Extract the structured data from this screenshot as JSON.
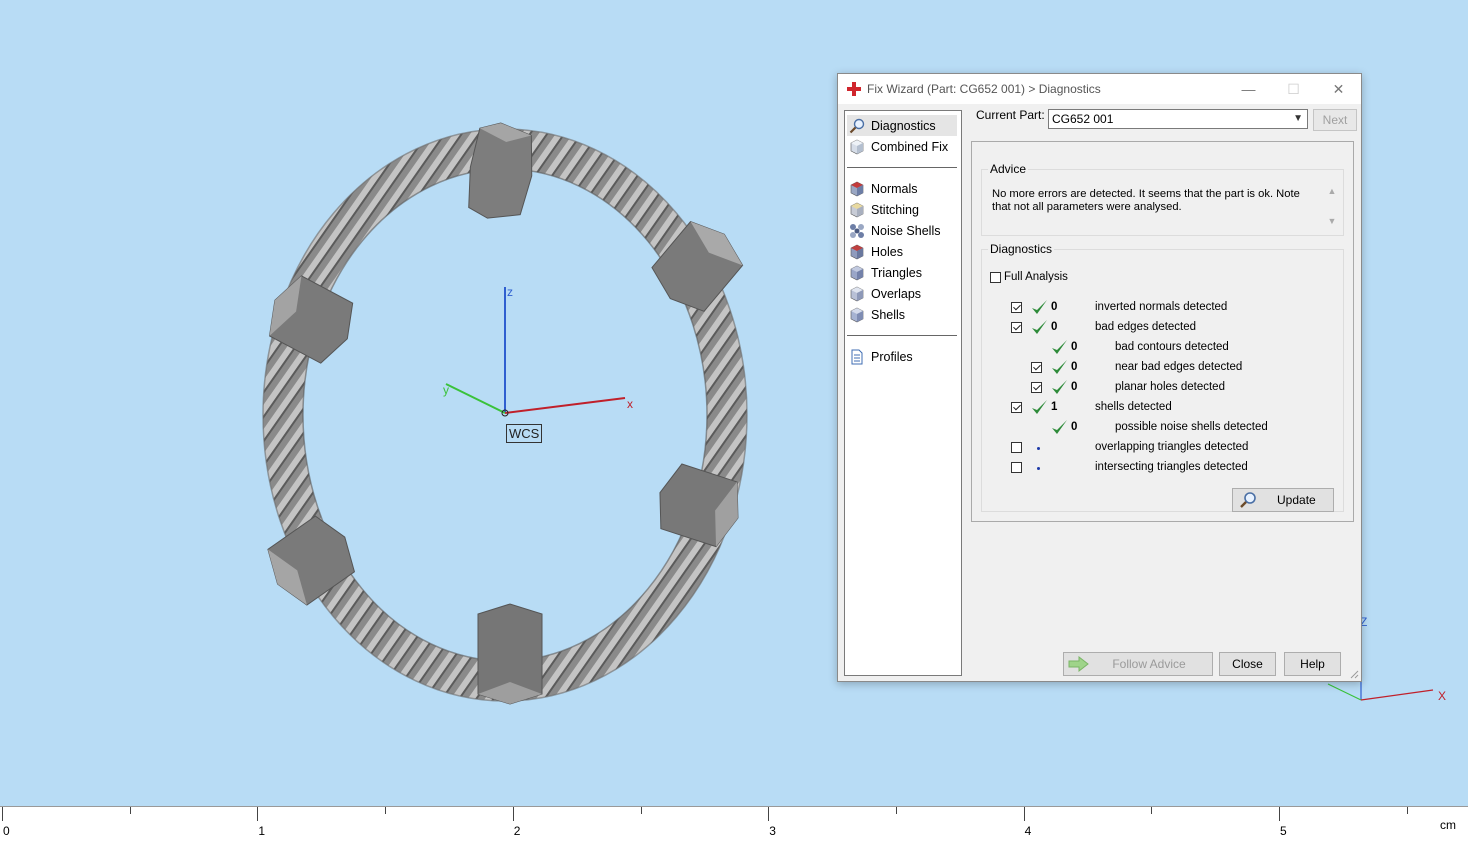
{
  "viewport": {
    "wcs_label": "WCS",
    "axis_labels": {
      "x": "x",
      "y": "y",
      "z": "z"
    },
    "mini_axis_labels": {
      "x": "X",
      "z": "Z"
    }
  },
  "ruler": {
    "ticks": [
      "0",
      "1",
      "2",
      "3",
      "4",
      "5"
    ],
    "unit": "cm"
  },
  "dialog": {
    "title": "Fix Wizard (Part: CG652 001) > Diagnostics",
    "window_buttons": {
      "minimize": "—",
      "maximize": "☐",
      "close": "✕"
    },
    "nav": {
      "top": [
        {
          "label": "Diagnostics",
          "icon": "magnifier-icon",
          "selected": true
        },
        {
          "label": "Combined Fix",
          "icon": "cube-icon"
        }
      ],
      "fixes": [
        {
          "label": "Normals",
          "icon": "normals-cube-icon"
        },
        {
          "label": "Stitching",
          "icon": "stitching-cube-icon"
        },
        {
          "label": "Noise Shells",
          "icon": "noise-shells-icon"
        },
        {
          "label": "Holes",
          "icon": "holes-cube-icon"
        },
        {
          "label": "Triangles",
          "icon": "triangles-cube-icon"
        },
        {
          "label": "Overlaps",
          "icon": "overlaps-cube-icon"
        },
        {
          "label": "Shells",
          "icon": "shells-cube-icon"
        }
      ],
      "bottom": [
        {
          "label": "Profiles",
          "icon": "document-icon"
        }
      ]
    },
    "current_part_label": "Current Part:",
    "current_part_value": "CG652 001",
    "next_label": "Next",
    "advice": {
      "legend": "Advice",
      "text": "No more errors are detected. It seems that the part is ok. Note that not all parameters were analysed."
    },
    "diagnostics": {
      "legend": "Diagnostics",
      "full_analysis_label": "Full Analysis",
      "rows": [
        {
          "checked": true,
          "status": "ok",
          "count": "0",
          "label": "inverted normals detected",
          "indent": 0,
          "has_checkbox": true
        },
        {
          "checked": true,
          "status": "ok",
          "count": "0",
          "label": "bad edges detected",
          "indent": 0,
          "has_checkbox": true
        },
        {
          "checked": false,
          "status": "ok",
          "count": "0",
          "label": "bad contours detected",
          "indent": 1,
          "has_checkbox": false
        },
        {
          "checked": true,
          "status": "ok",
          "count": "0",
          "label": "near bad edges detected",
          "indent": 1,
          "has_checkbox": true
        },
        {
          "checked": true,
          "status": "ok",
          "count": "0",
          "label": "planar holes detected",
          "indent": 1,
          "has_checkbox": true
        },
        {
          "checked": true,
          "status": "ok",
          "count": "1",
          "label": "shells detected",
          "indent": 0,
          "has_checkbox": true
        },
        {
          "checked": false,
          "status": "ok",
          "count": "0",
          "label": "possible noise shells detected",
          "indent": 1,
          "has_checkbox": false
        },
        {
          "checked": false,
          "status": "pending",
          "count": "",
          "label": "overlapping triangles detected",
          "indent": 0,
          "has_checkbox": true
        },
        {
          "checked": false,
          "status": "pending",
          "count": "",
          "label": "intersecting triangles detected",
          "indent": 0,
          "has_checkbox": true
        }
      ],
      "update_label": "Update"
    },
    "footer": {
      "follow_advice_label": "Follow Advice",
      "close_label": "Close",
      "help_label": "Help"
    },
    "colors": {
      "ok_check": "#2e8b3a",
      "pending_dot": "#1e3aa8",
      "brand_cross": "#d0262d"
    }
  }
}
